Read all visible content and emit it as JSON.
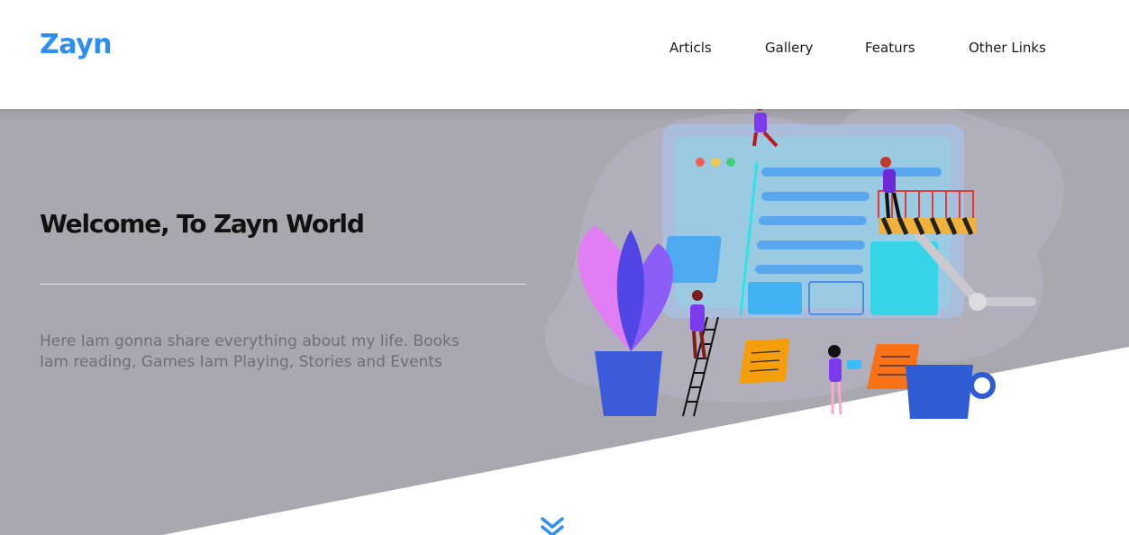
{
  "header": {
    "logo": "Zayn",
    "nav": [
      "Articls",
      "Gallery",
      "Featurs",
      "Other Links"
    ]
  },
  "hero": {
    "title": "Welcome, To Zayn World",
    "description": "Here Iam gonna share everything about my life. Books Iam reading, Games Iam Playing, Stories and Events"
  },
  "colors": {
    "brand": "#2e8ff2",
    "hero_bg": "#a9a8ae",
    "text_dark": "#111111",
    "text_muted": "#6f6e73"
  },
  "icons": {
    "scroll_down": "double-chevron-down-icon"
  }
}
